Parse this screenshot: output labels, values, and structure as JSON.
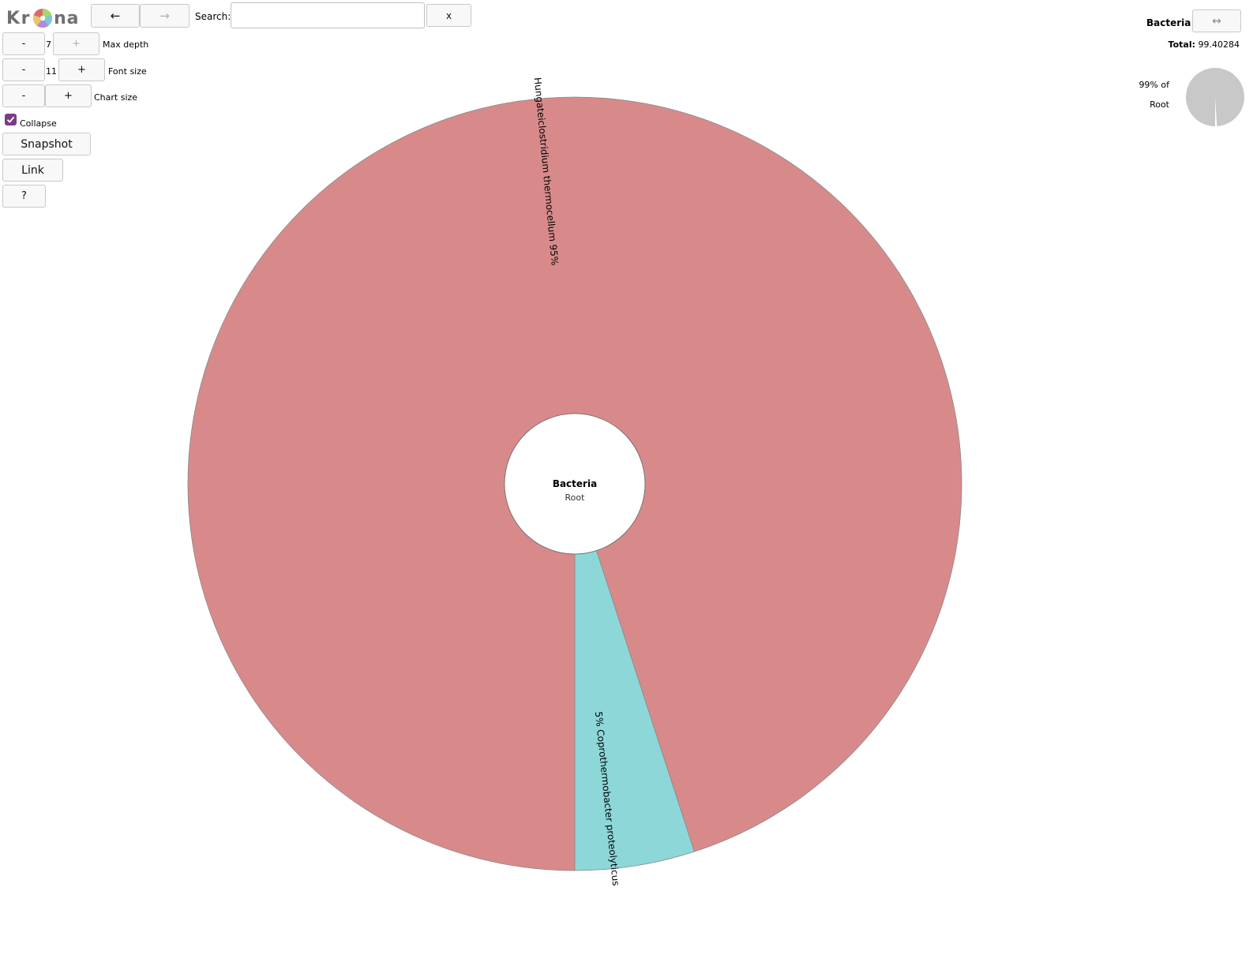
{
  "logo": {
    "letters": [
      "K",
      "r",
      "n",
      "a"
    ]
  },
  "nav": {
    "back": "←",
    "forward": "→"
  },
  "search": {
    "label": "Search:",
    "value": "",
    "placeholder": "",
    "clear": "x"
  },
  "controls": {
    "max_depth": {
      "minus": "-",
      "value": "7",
      "plus": "+",
      "label": "Max depth"
    },
    "font_size": {
      "minus": "-",
      "value": "11",
      "plus": "+",
      "label": "Font size"
    },
    "chart_size": {
      "minus": "-",
      "plus": "+",
      "label": "Chart size"
    },
    "collapse": {
      "label": "Collapse",
      "checked": true
    },
    "snapshot": "Snapshot",
    "link": "Link",
    "help": "?"
  },
  "details": {
    "name": "Bacteria",
    "swap": "↔",
    "total_label": "Total:",
    "total_value": "99.40284",
    "percent_of": "99% of",
    "parent": "Root",
    "parent_fraction": 0.99
  },
  "chart_data": {
    "type": "pie",
    "center": {
      "name": "Bacteria",
      "parent": "Root"
    },
    "slices": [
      {
        "name": "Hungateiclostridium thermocellum",
        "percent_label": "95%",
        "value": 95,
        "color": "#d88a8b"
      },
      {
        "name": "Coprothermobacter proteolyticus",
        "percent_label": "5%",
        "value": 5,
        "color": "#8dd7d9"
      }
    ]
  },
  "colors": {
    "accent": "#7a3c86",
    "pie_grey": "#c8c8c8"
  }
}
